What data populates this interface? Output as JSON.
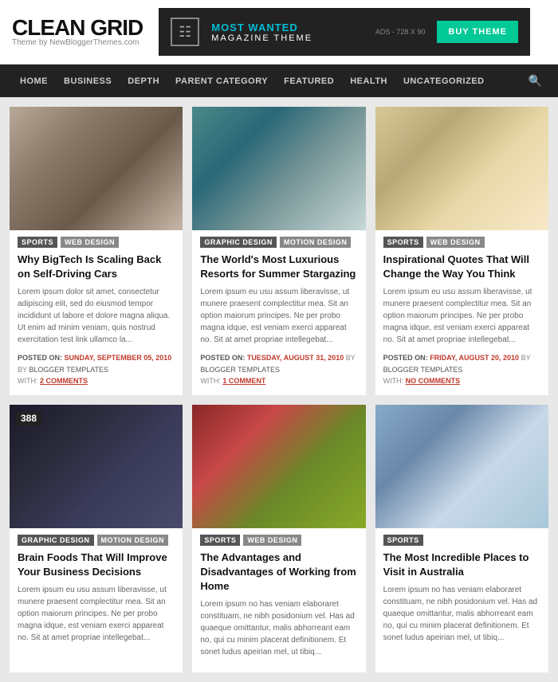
{
  "header": {
    "logo": {
      "title": "CLEAN GRID",
      "subtitle": "Theme by NewBloggerThemes.com"
    },
    "ad": {
      "most_wanted": "MOST WANTED",
      "magazine": "MAGAZINE THEME",
      "label": "ADS - 728 X 90",
      "buy_label": "BUY THEME"
    }
  },
  "nav": {
    "items": [
      {
        "label": "HOME",
        "href": "#"
      },
      {
        "label": "BUSINESS",
        "href": "#"
      },
      {
        "label": "DEPTH",
        "href": "#"
      },
      {
        "label": "PARENT CATEGORY",
        "href": "#"
      },
      {
        "label": "FEATURED",
        "href": "#"
      },
      {
        "label": "HEALTH",
        "href": "#"
      },
      {
        "label": "UNCATEGORIZED",
        "href": "#"
      }
    ]
  },
  "posts": [
    {
      "id": 1,
      "image_class": "img-woman-glasses",
      "badge": null,
      "tags": [
        {
          "label": "SPORTS",
          "class": "tag-sports"
        },
        {
          "label": "WEB DESIGN",
          "class": "tag-web-design"
        }
      ],
      "title": "Why BigTech Is Scaling Back on Self-Driving Cars",
      "excerpt": "Lorem ipsum dolor sit amet, consectetur adipiscing elit, sed do eiusmod tempor incididunt ut labore et dolore magna aliqua. Ut enim ad minim veniam, quis nostrud exercitation test link ullamco la...",
      "posted_on": "SUNDAY, SEPTEMBER 05, 2010",
      "author": "BLOGGER TEMPLATES",
      "comments": "2 COMMENTS",
      "comments_color": "red"
    },
    {
      "id": 2,
      "image_class": "img-girls-friends",
      "badge": null,
      "tags": [
        {
          "label": "GRAPHIC DESIGN",
          "class": "tag-graphic-design"
        },
        {
          "label": "MOTION DESIGN",
          "class": "tag-web-design"
        }
      ],
      "title": "The World's Most Luxurious Resorts for Summer Stargazing",
      "excerpt": "Lorem ipsum eu usu assum liberavisse, ut munere praesent complectitur mea. Sit an option maiorum principes. Ne per probo magna idque, est veniam exerci appareat no. Sit at amet propriae intellegebat...",
      "posted_on": "TUESDAY, AUGUST 31, 2010",
      "author": "BLOGGER TEMPLATES",
      "comments": "1 COMMENT",
      "comments_color": "red"
    },
    {
      "id": 3,
      "image_class": "img-blonde-girl",
      "badge": null,
      "tags": [
        {
          "label": "SPORTS",
          "class": "tag-sports"
        },
        {
          "label": "WEB DESIGN",
          "class": "tag-web-design"
        }
      ],
      "title": "Inspirational Quotes That Will Change the Way You Think",
      "excerpt": "Lorem ipsum eu usu assum liberavisse, ut munere praesent complectitur mea. Sit an option maiorum principes. Ne per probo magna idque, est veniam exerci appareat no. Sit at amet propriae intellegebat...",
      "posted_on": "FRIDAY, AUGUST 20, 2010",
      "author": "BLOGGER TEMPLATES",
      "comments": "NO COMMENTS",
      "comments_color": "red"
    },
    {
      "id": 4,
      "image_class": "img-women-sunglasses",
      "badge": "388",
      "tags": [
        {
          "label": "GRAPHIC DESIGN",
          "class": "tag-graphic-design"
        },
        {
          "label": "MOTION DESIGN",
          "class": "tag-web-design"
        }
      ],
      "title": "Brain Foods That Will Improve Your Business Decisions",
      "excerpt": "Lorem ipsum eu usu assum liberavisse, ut munere praesent complectitur mea. Sit an option maiorum principes. Ne per probo magna idque, est veniam exerci appareat no. Sit at amet propriae intellegebat...",
      "posted_on": null,
      "author": null,
      "comments": null,
      "comments_color": "red"
    },
    {
      "id": 5,
      "image_class": "img-girl-flowers",
      "badge": null,
      "tags": [
        {
          "label": "SPORTS",
          "class": "tag-sports"
        },
        {
          "label": "WEB DESIGN",
          "class": "tag-web-design"
        }
      ],
      "title": "The Advantages and Disadvantages of Working from Home",
      "excerpt": "Lorem ipsum no has veniam elaboraret constituam, ne nibh posidonium vel. Has ad quaeque omittantur, malis abhorreant eam no, qui cu minim placerat definitionem. Et sonet ludus apeirian mel, ut tibiq...",
      "posted_on": null,
      "author": null,
      "comments": null,
      "comments_color": "red"
    },
    {
      "id": 6,
      "image_class": "img-girl-pool",
      "badge": null,
      "tags": [
        {
          "label": "SPORTS",
          "class": "tag-sports"
        }
      ],
      "title": "The Most Incredible Places to Visit in Australia",
      "excerpt": "Lorem ipsum no has veniam elaboraret constituam, ne nibh posidonium vel. Has ad quaeque omittantur, malis abhorreant eam no, qui cu minim placerat definitionem. Et sonet ludus apeirian mel, ut tibiq...",
      "posted_on": null,
      "author": null,
      "comments": null,
      "comments_color": "red"
    }
  ]
}
